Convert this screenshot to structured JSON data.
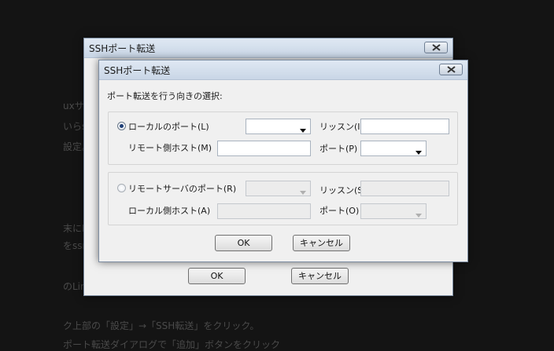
{
  "background": {
    "line1": "uxサーバを踏み台",
    "line2": "いらsshコマンドで",
    "line3": "設定。",
    "line4": "末にLinux/Cashを",
    "line5": "をssmsを使用し",
    "line6": "のLinux/Cash接続",
    "line7": "ク上部の「設定」→「SSH転送」をクリック。",
    "line8": "ポート転送ダイアログで「追加」ボタンをクリック"
  },
  "back_dialog": {
    "title": "SSHポート転送",
    "ok_label": "OK",
    "cancel_label": "キャンセル"
  },
  "dialog": {
    "title": "SSHポート転送",
    "direction_label": "ポート転送を行う向きの選択:",
    "local": {
      "radio_label": "ローカルのポート(L)",
      "port_value": "",
      "listen_label": "リッスン(I)",
      "listen_value": "",
      "remote_host_label": "リモート側ホスト(M)",
      "remote_host_value": "",
      "port_label": "ポート(P)",
      "remote_port_value": "",
      "selected": true
    },
    "remote": {
      "radio_label": "リモートサーバのポート(R)",
      "port_value": "",
      "listen_label": "リッスン(S)",
      "listen_value": "",
      "local_host_label": "ローカル側ホスト(A)",
      "local_host_value": "",
      "port_label": "ポート(O)",
      "local_port_value": "",
      "selected": false
    },
    "ok_label": "OK",
    "cancel_label": "キャンセル"
  },
  "colors": {
    "backdrop": "#141414",
    "dialog_bg": "#f0f0f0",
    "titlebar": "#c9d6e6"
  }
}
